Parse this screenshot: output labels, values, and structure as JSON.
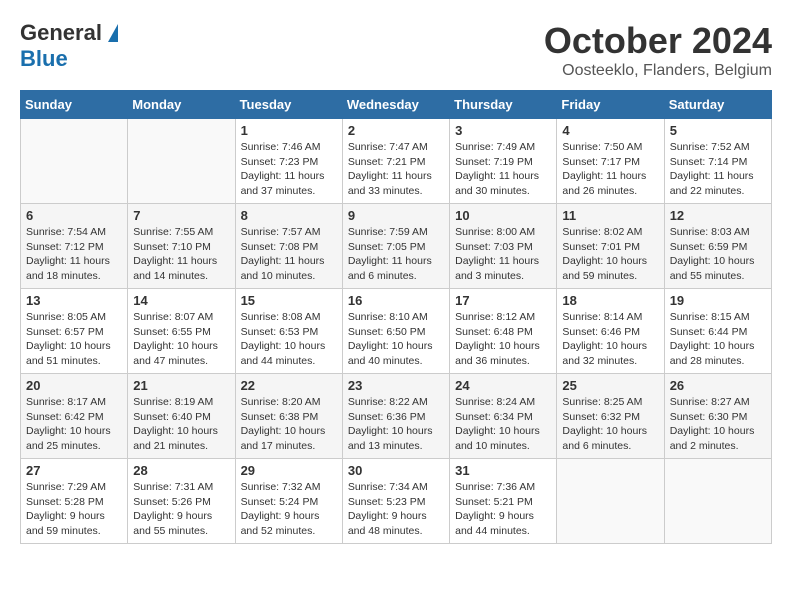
{
  "header": {
    "logo_general": "General",
    "logo_blue": "Blue",
    "month_title": "October 2024",
    "location": "Oosteeklo, Flanders, Belgium"
  },
  "days_of_week": [
    "Sunday",
    "Monday",
    "Tuesday",
    "Wednesday",
    "Thursday",
    "Friday",
    "Saturday"
  ],
  "weeks": [
    [
      {
        "day": "",
        "sunrise": "",
        "sunset": "",
        "daylight": ""
      },
      {
        "day": "",
        "sunrise": "",
        "sunset": "",
        "daylight": ""
      },
      {
        "day": "1",
        "sunrise": "Sunrise: 7:46 AM",
        "sunset": "Sunset: 7:23 PM",
        "daylight": "Daylight: 11 hours and 37 minutes."
      },
      {
        "day": "2",
        "sunrise": "Sunrise: 7:47 AM",
        "sunset": "Sunset: 7:21 PM",
        "daylight": "Daylight: 11 hours and 33 minutes."
      },
      {
        "day": "3",
        "sunrise": "Sunrise: 7:49 AM",
        "sunset": "Sunset: 7:19 PM",
        "daylight": "Daylight: 11 hours and 30 minutes."
      },
      {
        "day": "4",
        "sunrise": "Sunrise: 7:50 AM",
        "sunset": "Sunset: 7:17 PM",
        "daylight": "Daylight: 11 hours and 26 minutes."
      },
      {
        "day": "5",
        "sunrise": "Sunrise: 7:52 AM",
        "sunset": "Sunset: 7:14 PM",
        "daylight": "Daylight: 11 hours and 22 minutes."
      }
    ],
    [
      {
        "day": "6",
        "sunrise": "Sunrise: 7:54 AM",
        "sunset": "Sunset: 7:12 PM",
        "daylight": "Daylight: 11 hours and 18 minutes."
      },
      {
        "day": "7",
        "sunrise": "Sunrise: 7:55 AM",
        "sunset": "Sunset: 7:10 PM",
        "daylight": "Daylight: 11 hours and 14 minutes."
      },
      {
        "day": "8",
        "sunrise": "Sunrise: 7:57 AM",
        "sunset": "Sunset: 7:08 PM",
        "daylight": "Daylight: 11 hours and 10 minutes."
      },
      {
        "day": "9",
        "sunrise": "Sunrise: 7:59 AM",
        "sunset": "Sunset: 7:05 PM",
        "daylight": "Daylight: 11 hours and 6 minutes."
      },
      {
        "day": "10",
        "sunrise": "Sunrise: 8:00 AM",
        "sunset": "Sunset: 7:03 PM",
        "daylight": "Daylight: 11 hours and 3 minutes."
      },
      {
        "day": "11",
        "sunrise": "Sunrise: 8:02 AM",
        "sunset": "Sunset: 7:01 PM",
        "daylight": "Daylight: 10 hours and 59 minutes."
      },
      {
        "day": "12",
        "sunrise": "Sunrise: 8:03 AM",
        "sunset": "Sunset: 6:59 PM",
        "daylight": "Daylight: 10 hours and 55 minutes."
      }
    ],
    [
      {
        "day": "13",
        "sunrise": "Sunrise: 8:05 AM",
        "sunset": "Sunset: 6:57 PM",
        "daylight": "Daylight: 10 hours and 51 minutes."
      },
      {
        "day": "14",
        "sunrise": "Sunrise: 8:07 AM",
        "sunset": "Sunset: 6:55 PM",
        "daylight": "Daylight: 10 hours and 47 minutes."
      },
      {
        "day": "15",
        "sunrise": "Sunrise: 8:08 AM",
        "sunset": "Sunset: 6:53 PM",
        "daylight": "Daylight: 10 hours and 44 minutes."
      },
      {
        "day": "16",
        "sunrise": "Sunrise: 8:10 AM",
        "sunset": "Sunset: 6:50 PM",
        "daylight": "Daylight: 10 hours and 40 minutes."
      },
      {
        "day": "17",
        "sunrise": "Sunrise: 8:12 AM",
        "sunset": "Sunset: 6:48 PM",
        "daylight": "Daylight: 10 hours and 36 minutes."
      },
      {
        "day": "18",
        "sunrise": "Sunrise: 8:14 AM",
        "sunset": "Sunset: 6:46 PM",
        "daylight": "Daylight: 10 hours and 32 minutes."
      },
      {
        "day": "19",
        "sunrise": "Sunrise: 8:15 AM",
        "sunset": "Sunset: 6:44 PM",
        "daylight": "Daylight: 10 hours and 28 minutes."
      }
    ],
    [
      {
        "day": "20",
        "sunrise": "Sunrise: 8:17 AM",
        "sunset": "Sunset: 6:42 PM",
        "daylight": "Daylight: 10 hours and 25 minutes."
      },
      {
        "day": "21",
        "sunrise": "Sunrise: 8:19 AM",
        "sunset": "Sunset: 6:40 PM",
        "daylight": "Daylight: 10 hours and 21 minutes."
      },
      {
        "day": "22",
        "sunrise": "Sunrise: 8:20 AM",
        "sunset": "Sunset: 6:38 PM",
        "daylight": "Daylight: 10 hours and 17 minutes."
      },
      {
        "day": "23",
        "sunrise": "Sunrise: 8:22 AM",
        "sunset": "Sunset: 6:36 PM",
        "daylight": "Daylight: 10 hours and 13 minutes."
      },
      {
        "day": "24",
        "sunrise": "Sunrise: 8:24 AM",
        "sunset": "Sunset: 6:34 PM",
        "daylight": "Daylight: 10 hours and 10 minutes."
      },
      {
        "day": "25",
        "sunrise": "Sunrise: 8:25 AM",
        "sunset": "Sunset: 6:32 PM",
        "daylight": "Daylight: 10 hours and 6 minutes."
      },
      {
        "day": "26",
        "sunrise": "Sunrise: 8:27 AM",
        "sunset": "Sunset: 6:30 PM",
        "daylight": "Daylight: 10 hours and 2 minutes."
      }
    ],
    [
      {
        "day": "27",
        "sunrise": "Sunrise: 7:29 AM",
        "sunset": "Sunset: 5:28 PM",
        "daylight": "Daylight: 9 hours and 59 minutes."
      },
      {
        "day": "28",
        "sunrise": "Sunrise: 7:31 AM",
        "sunset": "Sunset: 5:26 PM",
        "daylight": "Daylight: 9 hours and 55 minutes."
      },
      {
        "day": "29",
        "sunrise": "Sunrise: 7:32 AM",
        "sunset": "Sunset: 5:24 PM",
        "daylight": "Daylight: 9 hours and 52 minutes."
      },
      {
        "day": "30",
        "sunrise": "Sunrise: 7:34 AM",
        "sunset": "Sunset: 5:23 PM",
        "daylight": "Daylight: 9 hours and 48 minutes."
      },
      {
        "day": "31",
        "sunrise": "Sunrise: 7:36 AM",
        "sunset": "Sunset: 5:21 PM",
        "daylight": "Daylight: 9 hours and 44 minutes."
      },
      {
        "day": "",
        "sunrise": "",
        "sunset": "",
        "daylight": ""
      },
      {
        "day": "",
        "sunrise": "",
        "sunset": "",
        "daylight": ""
      }
    ]
  ]
}
